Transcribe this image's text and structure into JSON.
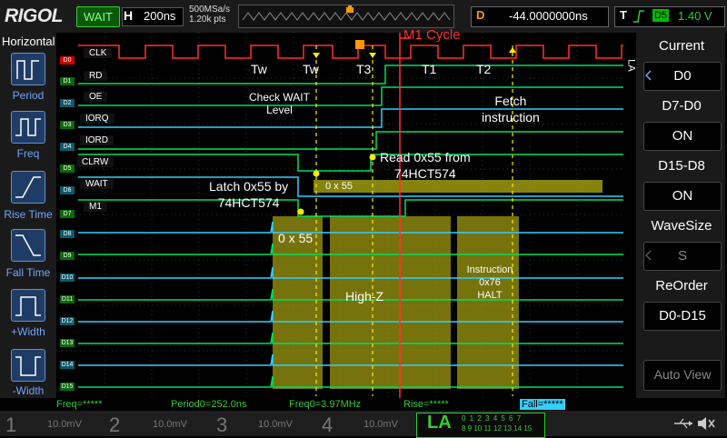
{
  "topbar": {
    "logo": "RIGOL",
    "run_status": "WAIT",
    "timebase_label": "H",
    "timebase_value": "200ns",
    "sample_rate": "500MSa/s",
    "memory_depth": "1.20k pts",
    "delay_label": "D",
    "delay_value": "-44.0000000ns",
    "trigger_label": "T",
    "trigger_source": "D5",
    "trigger_level": "1.40 V"
  },
  "left_panel": {
    "title": "Horizontal",
    "buttons": [
      "Period",
      "Freq",
      "Rise Time",
      "Fall Time",
      "+Width",
      "-Width"
    ]
  },
  "channels": {
    "tags": [
      "D0",
      "D1",
      "D2",
      "D3",
      "D4",
      "D5",
      "D6",
      "D7",
      "D8",
      "D9",
      "D10",
      "D11",
      "D12",
      "D13",
      "D14",
      "D15"
    ],
    "labels": [
      "CLK",
      "RD",
      "OE",
      "IORQ",
      "IORD",
      "CLRW",
      "WAIT",
      "M1"
    ]
  },
  "annotations": {
    "m1_cycle": "M1 Cycle",
    "tw1": "Tw",
    "tw2": "Tw",
    "t3": "T3",
    "t1": "T1",
    "t2": "T2",
    "check_wait": "Check WAIT\nLevel",
    "fetch": "Fetch\ninstruction",
    "read_from": "Read 0x55 from\n74HCT574",
    "latch": "Latch 0x55 by\n74HCT574",
    "bus_0x55": "0 x 55",
    "bus_small": "0 x 55",
    "highz": "High-Z",
    "instruction": "Instruction\n0x76\nHALT"
  },
  "right_menu": {
    "side_label": "LA",
    "items": [
      {
        "title": "Current",
        "value": "D0"
      },
      {
        "title": "D7-D0",
        "value": "ON"
      },
      {
        "title": "D15-D8",
        "value": "ON"
      },
      {
        "title": "WaveSize",
        "value": "S"
      },
      {
        "title": "ReOrder",
        "value": "D0-D15"
      },
      {
        "title": "Auto View",
        "value": ""
      }
    ]
  },
  "measurements": {
    "freq": "Freq=*****",
    "period0": "Period0=252.0ns",
    "freq0": "Freq0=3.97MHz",
    "rise": "Rise=*****",
    "fall": "Fall=*****"
  },
  "bottom": {
    "ch1_num": "1",
    "ch1_scale": "10.0mV",
    "ch2_num": "2",
    "ch2_scale": "10.0mV",
    "ch3_num": "3",
    "ch3_scale": "10.0mV",
    "ch4_num": "4",
    "ch4_scale": "10.0mV",
    "la": "LA",
    "la_digits_top": "0 1 2 3 4 5 6 7",
    "la_digits_bottom": "8 9 10 11 12 13 14 15"
  },
  "colors": {
    "trace": "#00e060",
    "cyan": "#30d0ff",
    "clk": "#ff3030",
    "bus": "#9e9a10",
    "cursor": "#ff3030",
    "yellow": "#ffee00"
  }
}
